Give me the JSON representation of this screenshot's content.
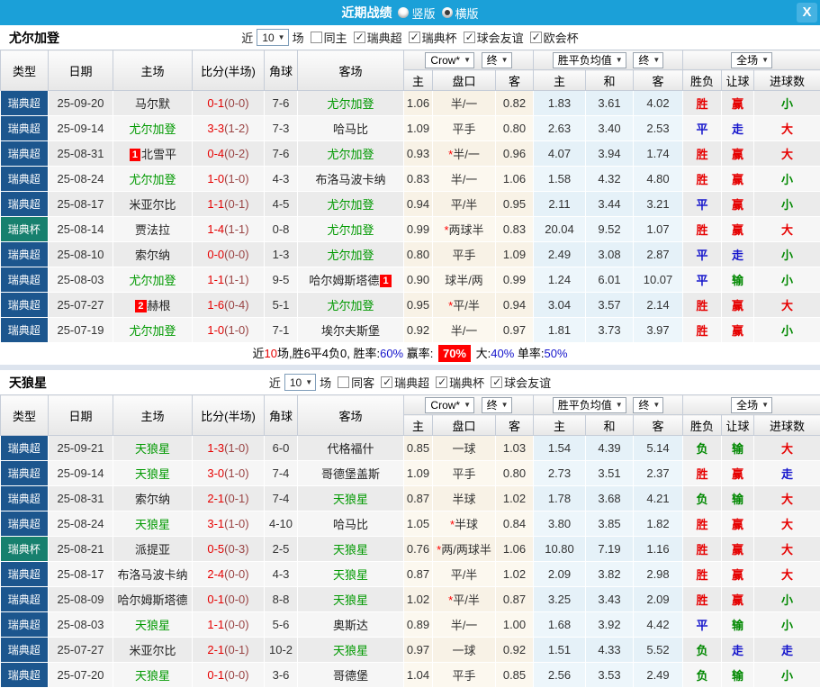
{
  "titlebar": {
    "title": "近期战绩",
    "options": [
      {
        "label": "竖版",
        "selected": false
      },
      {
        "label": "横版",
        "selected": true
      }
    ],
    "close": "X"
  },
  "columns": {
    "type": "类型",
    "date": "日期",
    "home": "主场",
    "score": "比分(半场)",
    "corner": "角球",
    "away": "客场",
    "odds_home": "主",
    "handicap": "盘口",
    "odds_away": "客",
    "avg_home": "主",
    "avg_draw": "和",
    "avg_away": "客",
    "result": "胜负",
    "cover": "让球",
    "goals": "进球数"
  },
  "dropdowns": {
    "company": "Crow*",
    "final": "终",
    "avg": "胜平负均值",
    "final2": "终",
    "scope": "全场"
  },
  "colors": {
    "accent_blue": "#1ba0d8",
    "league_badge": "#1c568e",
    "cup_badge": "#17806e",
    "win_red": "#e60000",
    "draw_blue": "#1515cc",
    "lose_green": "#008800",
    "team_green": "#009900",
    "highlight_red": "#ff0000",
    "avg_cell_blue": "#e5f1f8",
    "odds_cell_cream": "#f8f2e6"
  },
  "sections": [
    {
      "team": "尤尔加登",
      "filters": {
        "near": "近",
        "count": "10",
        "games": "场",
        "same": {
          "label": "同主",
          "checked": false
        },
        "comps": [
          {
            "label": "瑞典超",
            "checked": true
          },
          {
            "label": "瑞典杯",
            "checked": true
          },
          {
            "label": "球会友谊",
            "checked": true
          },
          {
            "label": "欧会杯",
            "checked": true
          }
        ]
      },
      "rows": [
        {
          "type": "瑞典超",
          "cup": false,
          "date": "25-09-20",
          "home": {
            "n": "马尔默"
          },
          "score": "0-1",
          "half": "(0-0)",
          "corner": "7-6",
          "away": {
            "n": "尤尔加登",
            "self": true
          },
          "o1": "1.06",
          "hc": "半/一",
          "o2": "0.82",
          "a1": "1.83",
          "a2": "3.61",
          "a3": "4.02",
          "res": "胜",
          "res_c": "r",
          "cov": "赢",
          "cov_c": "r",
          "gl": "小",
          "gl_c": "g"
        },
        {
          "type": "瑞典超",
          "cup": false,
          "date": "25-09-14",
          "home": {
            "n": "尤尔加登",
            "self": true
          },
          "score": "3-3",
          "half": "(1-2)",
          "corner": "7-3",
          "away": {
            "n": "哈马比"
          },
          "o1": "1.09",
          "hc": "平手",
          "o2": "0.80",
          "a1": "2.63",
          "a2": "3.40",
          "a3": "2.53",
          "res": "平",
          "res_c": "b",
          "cov": "走",
          "cov_c": "b",
          "gl": "大",
          "gl_c": "r"
        },
        {
          "type": "瑞典超",
          "cup": false,
          "date": "25-08-31",
          "home": {
            "n": "北雪平",
            "badge": "1",
            "pos": "before"
          },
          "score": "0-4",
          "half": "(0-2)",
          "corner": "7-6",
          "away": {
            "n": "尤尔加登",
            "self": true
          },
          "o1": "0.93",
          "star": "*",
          "hc": "半/一",
          "o2": "0.96",
          "a1": "4.07",
          "a2": "3.94",
          "a3": "1.74",
          "res": "胜",
          "res_c": "r",
          "cov": "赢",
          "cov_c": "r",
          "gl": "大",
          "gl_c": "r"
        },
        {
          "type": "瑞典超",
          "cup": false,
          "date": "25-08-24",
          "home": {
            "n": "尤尔加登",
            "self": true
          },
          "score": "1-0",
          "half": "(1-0)",
          "corner": "4-3",
          "away": {
            "n": "布洛马波卡纳"
          },
          "o1": "0.83",
          "hc": "半/一",
          "o2": "1.06",
          "a1": "1.58",
          "a2": "4.32",
          "a3": "4.80",
          "res": "胜",
          "res_c": "r",
          "cov": "赢",
          "cov_c": "r",
          "gl": "小",
          "gl_c": "g"
        },
        {
          "type": "瑞典超",
          "cup": false,
          "date": "25-08-17",
          "home": {
            "n": "米亚尔比"
          },
          "score": "1-1",
          "half": "(0-1)",
          "corner": "4-5",
          "away": {
            "n": "尤尔加登",
            "self": true
          },
          "o1": "0.94",
          "hc": "平/半",
          "o2": "0.95",
          "a1": "2.11",
          "a2": "3.44",
          "a3": "3.21",
          "res": "平",
          "res_c": "b",
          "cov": "赢",
          "cov_c": "r",
          "gl": "小",
          "gl_c": "g"
        },
        {
          "type": "瑞典杯",
          "cup": true,
          "date": "25-08-14",
          "home": {
            "n": "贾法拉"
          },
          "score": "1-4",
          "half": "(1-1)",
          "corner": "0-8",
          "away": {
            "n": "尤尔加登",
            "self": true
          },
          "o1": "0.99",
          "star": "*",
          "hc": "两球半",
          "o2": "0.83",
          "a1": "20.04",
          "a2": "9.52",
          "a3": "1.07",
          "res": "胜",
          "res_c": "r",
          "cov": "赢",
          "cov_c": "r",
          "gl": "大",
          "gl_c": "r"
        },
        {
          "type": "瑞典超",
          "cup": false,
          "date": "25-08-10",
          "home": {
            "n": "索尔纳"
          },
          "score": "0-0",
          "half": "(0-0)",
          "corner": "1-3",
          "away": {
            "n": "尤尔加登",
            "self": true
          },
          "o1": "0.80",
          "hc": "平手",
          "o2": "1.09",
          "a1": "2.49",
          "a2": "3.08",
          "a3": "2.87",
          "res": "平",
          "res_c": "b",
          "cov": "走",
          "cov_c": "b",
          "gl": "小",
          "gl_c": "g"
        },
        {
          "type": "瑞典超",
          "cup": false,
          "date": "25-08-03",
          "home": {
            "n": "尤尔加登",
            "self": true
          },
          "score": "1-1",
          "half": "(1-1)",
          "corner": "9-5",
          "away": {
            "n": "哈尔姆斯塔德",
            "badge": "1",
            "pos": "after"
          },
          "o1": "0.90",
          "hc": "球半/两",
          "o2": "0.99",
          "a1": "1.24",
          "a2": "6.01",
          "a3": "10.07",
          "res": "平",
          "res_c": "b",
          "cov": "输",
          "cov_c": "g",
          "gl": "小",
          "gl_c": "g"
        },
        {
          "type": "瑞典超",
          "cup": false,
          "date": "25-07-27",
          "home": {
            "n": "赫根",
            "badge": "2",
            "pos": "before"
          },
          "score": "1-6",
          "half": "(0-4)",
          "corner": "5-1",
          "away": {
            "n": "尤尔加登",
            "self": true
          },
          "o1": "0.95",
          "star": "*",
          "hc": "平/半",
          "o2": "0.94",
          "a1": "3.04",
          "a2": "3.57",
          "a3": "2.14",
          "res": "胜",
          "res_c": "r",
          "cov": "赢",
          "cov_c": "r",
          "gl": "大",
          "gl_c": "r"
        },
        {
          "type": "瑞典超",
          "cup": false,
          "date": "25-07-19",
          "home": {
            "n": "尤尔加登",
            "self": true
          },
          "score": "1-0",
          "half": "(1-0)",
          "corner": "7-1",
          "away": {
            "n": "埃尔夫斯堡"
          },
          "o1": "0.92",
          "hc": "半/一",
          "o2": "0.97",
          "a1": "1.81",
          "a2": "3.73",
          "a3": "3.97",
          "res": "胜",
          "res_c": "r",
          "cov": "赢",
          "cov_c": "r",
          "gl": "小",
          "gl_c": "g"
        }
      ],
      "summary": [
        {
          "t": "近",
          "c": "k"
        },
        {
          "t": "10",
          "c": "r"
        },
        {
          "t": "场,胜6平4负0, 胜率:",
          "c": "k"
        },
        {
          "t": "60%",
          "c": "b"
        },
        {
          "t": " 赢率: ",
          "c": "k"
        },
        {
          "t": "70%",
          "c": "hl"
        },
        {
          "t": " 大:",
          "c": "k"
        },
        {
          "t": "40%",
          "c": "b"
        },
        {
          "t": " 单率:",
          "c": "k"
        },
        {
          "t": "50%",
          "c": "b"
        }
      ]
    },
    {
      "team": "天狼星",
      "filters": {
        "near": "近",
        "count": "10",
        "games": "场",
        "same": {
          "label": "同客",
          "checked": false
        },
        "comps": [
          {
            "label": "瑞典超",
            "checked": true
          },
          {
            "label": "瑞典杯",
            "checked": true
          },
          {
            "label": "球会友谊",
            "checked": true
          }
        ]
      },
      "rows": [
        {
          "type": "瑞典超",
          "cup": false,
          "date": "25-09-21",
          "home": {
            "n": "天狼星",
            "self": true
          },
          "score": "1-3",
          "half": "(1-0)",
          "corner": "6-0",
          "away": {
            "n": "代格福什"
          },
          "o1": "0.85",
          "hc": "一球",
          "o2": "1.03",
          "a1": "1.54",
          "a2": "4.39",
          "a3": "5.14",
          "res": "负",
          "res_c": "g",
          "cov": "输",
          "cov_c": "g",
          "gl": "大",
          "gl_c": "r"
        },
        {
          "type": "瑞典超",
          "cup": false,
          "date": "25-09-14",
          "home": {
            "n": "天狼星",
            "self": true
          },
          "score": "3-0",
          "half": "(1-0)",
          "corner": "7-4",
          "away": {
            "n": "哥德堡盖斯"
          },
          "o1": "1.09",
          "hc": "平手",
          "o2": "0.80",
          "a1": "2.73",
          "a2": "3.51",
          "a3": "2.37",
          "res": "胜",
          "res_c": "r",
          "cov": "赢",
          "cov_c": "r",
          "gl": "走",
          "gl_c": "b"
        },
        {
          "type": "瑞典超",
          "cup": false,
          "date": "25-08-31",
          "home": {
            "n": "索尔纳"
          },
          "score": "2-1",
          "half": "(0-1)",
          "corner": "7-4",
          "away": {
            "n": "天狼星",
            "self": true
          },
          "o1": "0.87",
          "hc": "半球",
          "o2": "1.02",
          "a1": "1.78",
          "a2": "3.68",
          "a3": "4.21",
          "res": "负",
          "res_c": "g",
          "cov": "输",
          "cov_c": "g",
          "gl": "大",
          "gl_c": "r"
        },
        {
          "type": "瑞典超",
          "cup": false,
          "date": "25-08-24",
          "home": {
            "n": "天狼星",
            "self": true
          },
          "score": "3-1",
          "half": "(1-0)",
          "corner": "4-10",
          "away": {
            "n": "哈马比"
          },
          "o1": "1.05",
          "star": "*",
          "hc": "半球",
          "o2": "0.84",
          "a1": "3.80",
          "a2": "3.85",
          "a3": "1.82",
          "res": "胜",
          "res_c": "r",
          "cov": "赢",
          "cov_c": "r",
          "gl": "大",
          "gl_c": "r"
        },
        {
          "type": "瑞典杯",
          "cup": true,
          "date": "25-08-21",
          "home": {
            "n": "派提亚"
          },
          "score": "0-5",
          "half": "(0-3)",
          "corner": "2-5",
          "away": {
            "n": "天狼星",
            "self": true
          },
          "o1": "0.76",
          "star": "*",
          "hc": "两/两球半",
          "o2": "1.06",
          "a1": "10.80",
          "a2": "7.19",
          "a3": "1.16",
          "res": "胜",
          "res_c": "r",
          "cov": "赢",
          "cov_c": "r",
          "gl": "大",
          "gl_c": "r"
        },
        {
          "type": "瑞典超",
          "cup": false,
          "date": "25-08-17",
          "home": {
            "n": "布洛马波卡纳"
          },
          "score": "2-4",
          "half": "(0-0)",
          "corner": "4-3",
          "away": {
            "n": "天狼星",
            "self": true
          },
          "o1": "0.87",
          "hc": "平/半",
          "o2": "1.02",
          "a1": "2.09",
          "a2": "3.82",
          "a3": "2.98",
          "res": "胜",
          "res_c": "r",
          "cov": "赢",
          "cov_c": "r",
          "gl": "大",
          "gl_c": "r"
        },
        {
          "type": "瑞典超",
          "cup": false,
          "date": "25-08-09",
          "home": {
            "n": "哈尔姆斯塔德"
          },
          "score": "0-1",
          "half": "(0-0)",
          "corner": "8-8",
          "away": {
            "n": "天狼星",
            "self": true
          },
          "o1": "1.02",
          "star": "*",
          "hc": "平/半",
          "o2": "0.87",
          "a1": "3.25",
          "a2": "3.43",
          "a3": "2.09",
          "res": "胜",
          "res_c": "r",
          "cov": "赢",
          "cov_c": "r",
          "gl": "小",
          "gl_c": "g"
        },
        {
          "type": "瑞典超",
          "cup": false,
          "date": "25-08-03",
          "home": {
            "n": "天狼星",
            "self": true
          },
          "score": "1-1",
          "half": "(0-0)",
          "corner": "5-6",
          "away": {
            "n": "奥斯达"
          },
          "o1": "0.89",
          "hc": "半/一",
          "o2": "1.00",
          "a1": "1.68",
          "a2": "3.92",
          "a3": "4.42",
          "res": "平",
          "res_c": "b",
          "cov": "输",
          "cov_c": "g",
          "gl": "小",
          "gl_c": "g"
        },
        {
          "type": "瑞典超",
          "cup": false,
          "date": "25-07-27",
          "home": {
            "n": "米亚尔比"
          },
          "score": "2-1",
          "half": "(0-1)",
          "corner": "10-2",
          "away": {
            "n": "天狼星",
            "self": true
          },
          "o1": "0.97",
          "hc": "一球",
          "o2": "0.92",
          "a1": "1.51",
          "a2": "4.33",
          "a3": "5.52",
          "res": "负",
          "res_c": "g",
          "cov": "走",
          "cov_c": "b",
          "gl": "走",
          "gl_c": "b"
        },
        {
          "type": "瑞典超",
          "cup": false,
          "date": "25-07-20",
          "home": {
            "n": "天狼星",
            "self": true
          },
          "score": "0-1",
          "half": "(0-0)",
          "corner": "3-6",
          "away": {
            "n": "哥德堡"
          },
          "o1": "1.04",
          "hc": "平手",
          "o2": "0.85",
          "a1": "2.56",
          "a2": "3.53",
          "a3": "2.49",
          "res": "负",
          "res_c": "g",
          "cov": "输",
          "cov_c": "g",
          "gl": "小",
          "gl_c": "g"
        }
      ]
    }
  ]
}
